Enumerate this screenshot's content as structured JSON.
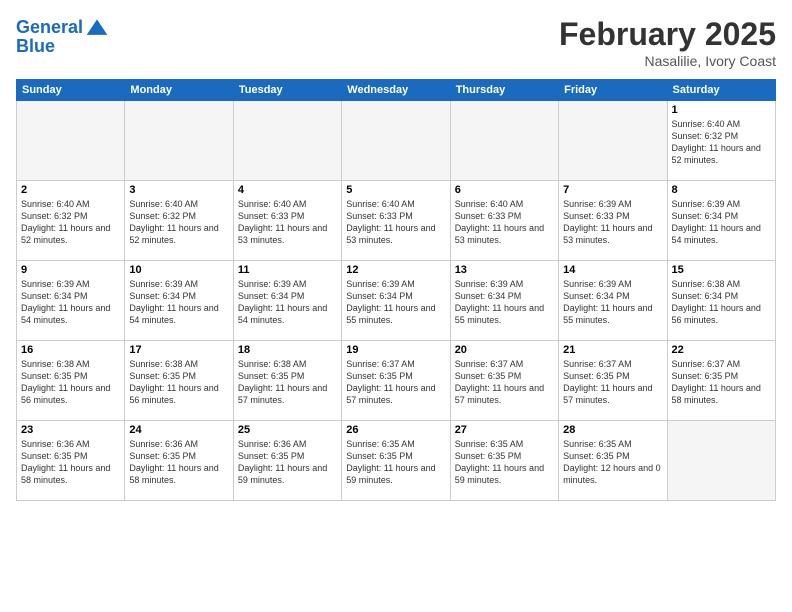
{
  "header": {
    "logo_line1": "General",
    "logo_line2": "Blue",
    "month_title": "February 2025",
    "location": "Nasalilie, Ivory Coast"
  },
  "weekdays": [
    "Sunday",
    "Monday",
    "Tuesday",
    "Wednesday",
    "Thursday",
    "Friday",
    "Saturday"
  ],
  "weeks": [
    [
      {
        "day": "",
        "info": ""
      },
      {
        "day": "",
        "info": ""
      },
      {
        "day": "",
        "info": ""
      },
      {
        "day": "",
        "info": ""
      },
      {
        "day": "",
        "info": ""
      },
      {
        "day": "",
        "info": ""
      },
      {
        "day": "1",
        "info": "Sunrise: 6:40 AM\nSunset: 6:32 PM\nDaylight: 11 hours and 52 minutes."
      }
    ],
    [
      {
        "day": "2",
        "info": "Sunrise: 6:40 AM\nSunset: 6:32 PM\nDaylight: 11 hours and 52 minutes."
      },
      {
        "day": "3",
        "info": "Sunrise: 6:40 AM\nSunset: 6:32 PM\nDaylight: 11 hours and 52 minutes."
      },
      {
        "day": "4",
        "info": "Sunrise: 6:40 AM\nSunset: 6:33 PM\nDaylight: 11 hours and 53 minutes."
      },
      {
        "day": "5",
        "info": "Sunrise: 6:40 AM\nSunset: 6:33 PM\nDaylight: 11 hours and 53 minutes."
      },
      {
        "day": "6",
        "info": "Sunrise: 6:40 AM\nSunset: 6:33 PM\nDaylight: 11 hours and 53 minutes."
      },
      {
        "day": "7",
        "info": "Sunrise: 6:39 AM\nSunset: 6:33 PM\nDaylight: 11 hours and 53 minutes."
      },
      {
        "day": "8",
        "info": "Sunrise: 6:39 AM\nSunset: 6:34 PM\nDaylight: 11 hours and 54 minutes."
      }
    ],
    [
      {
        "day": "9",
        "info": "Sunrise: 6:39 AM\nSunset: 6:34 PM\nDaylight: 11 hours and 54 minutes."
      },
      {
        "day": "10",
        "info": "Sunrise: 6:39 AM\nSunset: 6:34 PM\nDaylight: 11 hours and 54 minutes."
      },
      {
        "day": "11",
        "info": "Sunrise: 6:39 AM\nSunset: 6:34 PM\nDaylight: 11 hours and 54 minutes."
      },
      {
        "day": "12",
        "info": "Sunrise: 6:39 AM\nSunset: 6:34 PM\nDaylight: 11 hours and 55 minutes."
      },
      {
        "day": "13",
        "info": "Sunrise: 6:39 AM\nSunset: 6:34 PM\nDaylight: 11 hours and 55 minutes."
      },
      {
        "day": "14",
        "info": "Sunrise: 6:39 AM\nSunset: 6:34 PM\nDaylight: 11 hours and 55 minutes."
      },
      {
        "day": "15",
        "info": "Sunrise: 6:38 AM\nSunset: 6:34 PM\nDaylight: 11 hours and 56 minutes."
      }
    ],
    [
      {
        "day": "16",
        "info": "Sunrise: 6:38 AM\nSunset: 6:35 PM\nDaylight: 11 hours and 56 minutes."
      },
      {
        "day": "17",
        "info": "Sunrise: 6:38 AM\nSunset: 6:35 PM\nDaylight: 11 hours and 56 minutes."
      },
      {
        "day": "18",
        "info": "Sunrise: 6:38 AM\nSunset: 6:35 PM\nDaylight: 11 hours and 57 minutes."
      },
      {
        "day": "19",
        "info": "Sunrise: 6:37 AM\nSunset: 6:35 PM\nDaylight: 11 hours and 57 minutes."
      },
      {
        "day": "20",
        "info": "Sunrise: 6:37 AM\nSunset: 6:35 PM\nDaylight: 11 hours and 57 minutes."
      },
      {
        "day": "21",
        "info": "Sunrise: 6:37 AM\nSunset: 6:35 PM\nDaylight: 11 hours and 57 minutes."
      },
      {
        "day": "22",
        "info": "Sunrise: 6:37 AM\nSunset: 6:35 PM\nDaylight: 11 hours and 58 minutes."
      }
    ],
    [
      {
        "day": "23",
        "info": "Sunrise: 6:36 AM\nSunset: 6:35 PM\nDaylight: 11 hours and 58 minutes."
      },
      {
        "day": "24",
        "info": "Sunrise: 6:36 AM\nSunset: 6:35 PM\nDaylight: 11 hours and 58 minutes."
      },
      {
        "day": "25",
        "info": "Sunrise: 6:36 AM\nSunset: 6:35 PM\nDaylight: 11 hours and 59 minutes."
      },
      {
        "day": "26",
        "info": "Sunrise: 6:35 AM\nSunset: 6:35 PM\nDaylight: 11 hours and 59 minutes."
      },
      {
        "day": "27",
        "info": "Sunrise: 6:35 AM\nSunset: 6:35 PM\nDaylight: 11 hours and 59 minutes."
      },
      {
        "day": "28",
        "info": "Sunrise: 6:35 AM\nSunset: 6:35 PM\nDaylight: 12 hours and 0 minutes."
      },
      {
        "day": "",
        "info": ""
      }
    ]
  ]
}
